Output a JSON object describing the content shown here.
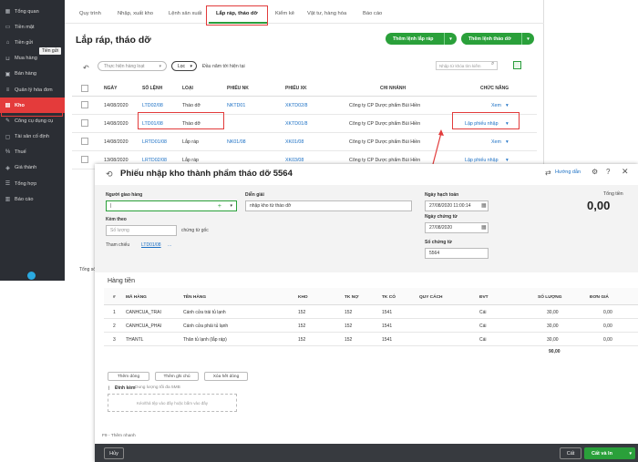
{
  "sidebar": {
    "items": [
      {
        "label": "Tổng quan",
        "icon": "dashboard-icon"
      },
      {
        "label": "Tiền mặt",
        "icon": "cash-icon"
      },
      {
        "label": "Tiền gửi",
        "icon": "bank-icon"
      },
      {
        "label": "Mua hàng",
        "icon": "cart-icon"
      },
      {
        "label": "Bán hàng",
        "icon": "sales-icon"
      },
      {
        "label": "Quản lý hóa đơn",
        "icon": "invoice-icon"
      },
      {
        "label": "Kho",
        "icon": "warehouse-icon"
      },
      {
        "label": "Công cụ dụng cụ",
        "icon": "tools-icon"
      },
      {
        "label": "Tài sản cố định",
        "icon": "asset-icon"
      },
      {
        "label": "Thuế",
        "icon": "tax-icon"
      },
      {
        "label": "Giá thành",
        "icon": "cost-icon"
      },
      {
        "label": "Tổng hợp",
        "icon": "summary-icon"
      },
      {
        "label": "Báo cáo",
        "icon": "report-icon"
      }
    ],
    "tooltip": "Tiền gửi"
  },
  "tabs": [
    "Quy trình",
    "Nhập, xuất kho",
    "Lệnh sản xuất",
    "Lắp ráp, tháo dỡ",
    "Kiểm kê",
    "Vật tư, hàng hóa",
    "Báo cáo"
  ],
  "page": {
    "title": "Lắp ráp, tháo dỡ",
    "btn_assembly": "Thêm lệnh lắp ráp",
    "btn_disassembly": "Thêm lệnh tháo dỡ",
    "bulk_action": "Thực hiện hàng loạt",
    "filter": "Lọc",
    "period": "Đầu năm tới hiện tại",
    "search_placeholder": "Nhập từ khóa tìm kiếm",
    "total_label": "Tổng số"
  },
  "table": {
    "headers": [
      "NGÀY",
      "SỐ LỆNH",
      "LOẠI",
      "PHIẾU NK",
      "PHIẾU XK",
      "CHI NHÁNH",
      "CHỨC NĂNG"
    ],
    "rows": [
      {
        "date": "14/08/2020",
        "order": "LTD02/08",
        "type": "Tháo dỡ",
        "nk": "NKTD01",
        "xk": "XKTD02/8",
        "branch": "Công ty CP Dược phẩm Bùi Hiền",
        "action": "Xem"
      },
      {
        "date": "14/08/2020",
        "order": "LTD01/08",
        "type": "Tháo dỡ",
        "nk": "",
        "xk": "XKTD01/8",
        "branch": "Công ty CP Dược phẩm Bùi Hiền",
        "action": "Lập phiếu nhập"
      },
      {
        "date": "14/08/2020",
        "order": "LRTD01/08",
        "type": "Lắp ráp",
        "nk": "NK01/08",
        "xk": "XK01/08",
        "branch": "Công ty CP Dược phẩm Bùi Hiền",
        "action": "Xem"
      },
      {
        "date": "13/08/2020",
        "order": "LRTD02/08",
        "type": "Lắp ráp",
        "nk": "",
        "xk": "XK03/08",
        "branch": "Công ty CP Dược phẩm Bùi Hiền",
        "action": "Lập phiếu nhập"
      }
    ]
  },
  "dialog": {
    "title": "Phiếu nhập kho thành phẩm tháo dỡ 5564",
    "help": "Hướng dẫn",
    "deliverer_label": "Người giao hàng",
    "description_label": "Diễn giải",
    "description_value": "nhập kho từ tháo dỡ",
    "attach_label": "Kèm theo",
    "attach_placeholder": "Số lượng",
    "attach_suffix": "chứng từ gốc",
    "reference_label": "Tham chiếu",
    "reference_value": "LTD01/08",
    "reference_more": "...",
    "posting_date_label": "Ngày hạch toán",
    "posting_date_value": "27/08/2020 11:00:14",
    "doc_date_label": "Ngày chứng từ",
    "doc_date_value": "27/08/2020",
    "doc_no_label": "Số chứng từ",
    "doc_no_value": "5564",
    "total_label": "Tổng tiền",
    "total_value": "0,00",
    "section": "Hàng tiền",
    "line_headers": [
      "#",
      "MÃ HÀNG",
      "TÊN HÀNG",
      "KHO",
      "TK NỢ",
      "TK CÓ",
      "QUY CÁCH",
      "ĐVT",
      "SỐ LƯỢNG",
      "ĐƠN GIÁ"
    ],
    "lines": [
      {
        "no": "1",
        "code": "CANHCUA_TRAI",
        "name": "Cánh cửa trái tủ lạnh",
        "store": "152",
        "debit": "152",
        "credit": "1541",
        "spec": "",
        "unit": "Cái",
        "qty": "30,00",
        "price": "0,00"
      },
      {
        "no": "2",
        "code": "CANHCUA_PHAI",
        "name": "Cánh cửa phải tủ lạnh",
        "store": "152",
        "debit": "152",
        "credit": "1541",
        "spec": "",
        "unit": "Cái",
        "qty": "30,00",
        "price": "0,00"
      },
      {
        "no": "3",
        "code": "THANTL",
        "name": "Thân tủ lạnh (lắp ráp)",
        "store": "152",
        "debit": "152",
        "credit": "1541",
        "spec": "",
        "unit": "Cái",
        "qty": "30,00",
        "price": "0,00"
      }
    ],
    "qty_total": "90,00",
    "btn_add_line": "Thêm dòng",
    "btn_add_note": "Thêm ghi chú",
    "btn_delete_all": "Xóa hết dòng",
    "attach_file_label": "Đính kèm",
    "attach_file_hint": "Dung lượng tối đa 5MB",
    "drop_hint": "Kéo/thả tệp vào đây hoặc bấm vào đây",
    "shortcut_hint": "F9 - Thêm nhanh",
    "btn_cancel": "Hủy",
    "btn_save": "Cất",
    "btn_save_print": "Cất và In"
  },
  "colors": {
    "accent": "#2aa03a",
    "highlight": "#e23b3b",
    "sidebar": "#2b2e34",
    "link": "#1a6fc4"
  }
}
